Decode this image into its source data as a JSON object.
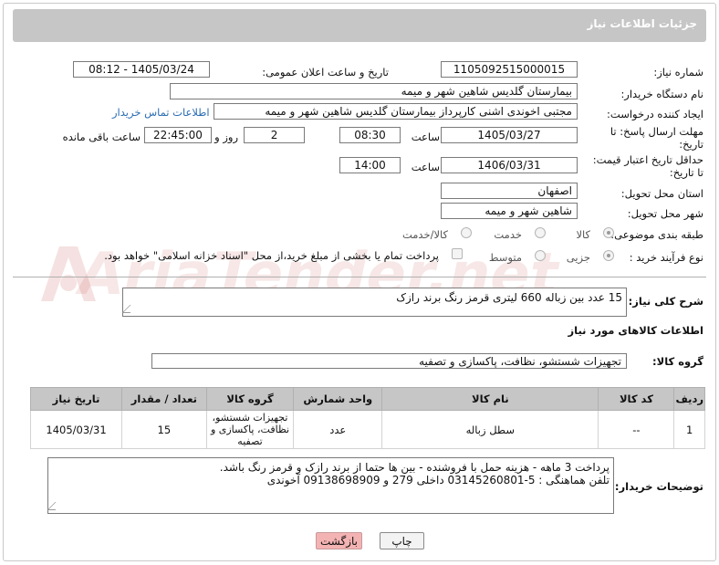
{
  "header": {
    "title": "جزئیات اطلاعات نیاز"
  },
  "need_number": {
    "label": "شماره نیاز:",
    "value": "1105092515000015"
  },
  "announce": {
    "label": "تاریخ و ساعت اعلان عمومی:",
    "value": "1405/03/24 - 08:12"
  },
  "buyer_org": {
    "label": "نام دستگاه خریدار:",
    "value": "بیمارستان گلدیس  شاهین شهر و میمه"
  },
  "requester": {
    "label": "ایجاد کننده درخواست:",
    "value": "مجتبی اخوندی اشنی کارپرداز بیمارستان گلدیس  شاهین شهر و میمه",
    "contact_link": "اطلاعات تماس خریدار"
  },
  "deadline": {
    "label_line1": "مهلت ارسال پاسخ: تا",
    "label_line2": "تاریخ:",
    "date": "1405/03/27",
    "time_label": "ساعت",
    "time": "08:30",
    "days": "2",
    "days_label": "روز و",
    "remaining": "22:45:00",
    "remaining_label": "ساعت باقی مانده"
  },
  "validity": {
    "label_line1": "حداقل تاریخ اعتبار قیمت:",
    "label_line2": "تا تاریخ:",
    "date": "1406/03/31",
    "time_label": "ساعت",
    "time": "14:00"
  },
  "province": {
    "label": "استان محل تحویل:",
    "value": "اصفهان"
  },
  "city": {
    "label": "شهر محل تحویل:",
    "value": "شاهین شهر و میمه"
  },
  "category": {
    "label": "طبقه بندی موضوعی:",
    "options": [
      "کالا",
      "خدمت",
      "کالا/خدمت"
    ],
    "selected": "کالا"
  },
  "purchase_type": {
    "label": "نوع فرآیند خرید :",
    "options": [
      "جزیی",
      "متوسط"
    ],
    "selected": "جزیی",
    "note": "پرداخت تمام یا بخشی از مبلغ خرید،از محل \"اسناد خزانه اسلامی\" خواهد بود."
  },
  "need_summary": {
    "label": "شرح کلی نیاز:",
    "value": "15 عدد بین زباله 660 لیتری قرمز رنگ برند رازک"
  },
  "goods_info": {
    "title": "اطلاعات کالاهای مورد نیاز"
  },
  "goods_group": {
    "label": "گروه کالا:",
    "value": "تجهیزات شستشو، نظافت، پاکسازی و تصفیه"
  },
  "table": {
    "headers": [
      "ردیف",
      "کد کالا",
      "نام کالا",
      "واحد شمارش",
      "گروه کالا",
      "تعداد / مقدار",
      "تاریخ نیاز"
    ],
    "rows": [
      {
        "row": "1",
        "code": "--",
        "name": "سطل زباله",
        "unit": "عدد",
        "group": "تجهیزات شستشو، نظافت، پاکسازی و تصفیه",
        "qty": "15",
        "date": "1405/03/31"
      }
    ]
  },
  "buyer_notes": {
    "label": "توضیحات خریدار:",
    "line1": "پرداخت 3 ماهه - هزینه حمل با فروشنده - بین ها حتما از برند رازک و قرمز رنگ باشد.",
    "line2": "تلفن هماهنگی : 5-03145260801 داخلی 279 و 09138698909 آخوندی"
  },
  "buttons": {
    "print": "چاپ",
    "back": "بازگشت"
  },
  "watermark": {
    "text": "AriaTender.net"
  },
  "colors": {
    "header_bg": "#c6c6c6",
    "link": "#2a6db2",
    "back_button": "#f4b3b3"
  }
}
